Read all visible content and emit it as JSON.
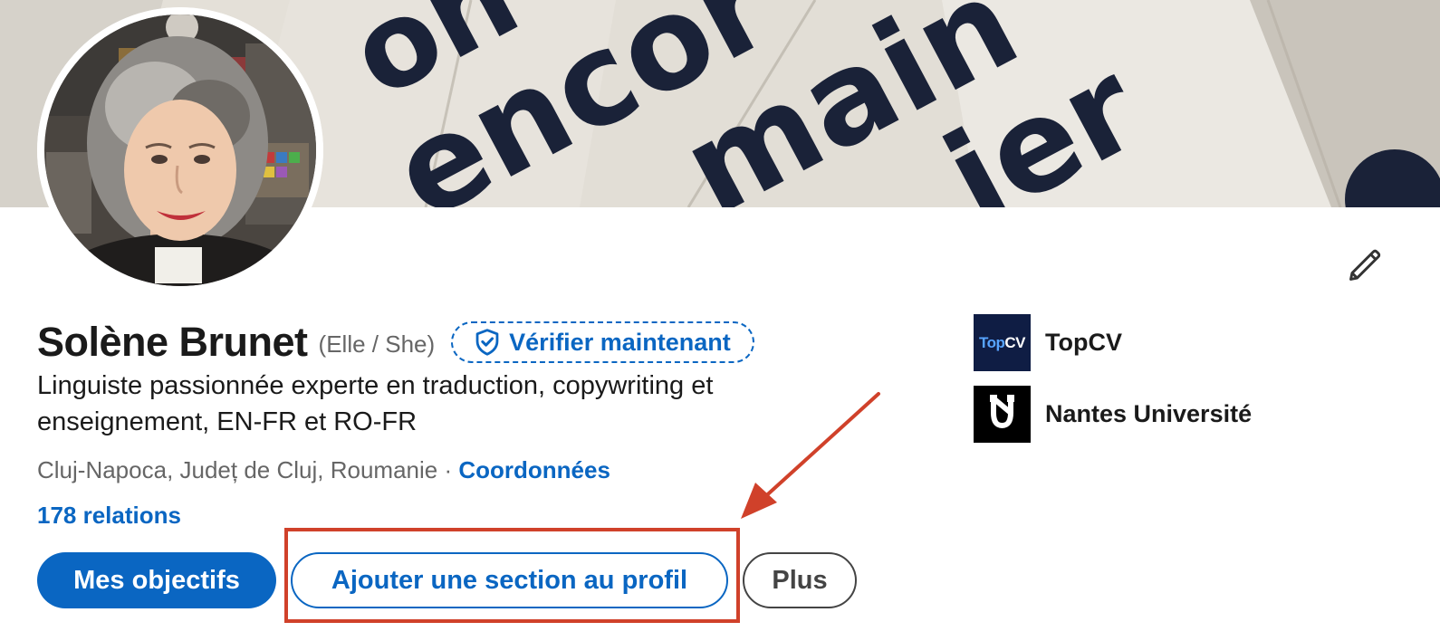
{
  "profile": {
    "name": "Solène Brunet",
    "pronouns": "(Elle / She)",
    "verify_label": "Vérifier maintenant",
    "headline": "Linguiste passionnée experte en traduction, copywriting et enseignement, EN-FR et RO-FR",
    "location": "Cluj-Napoca, Județ de Cluj, Roumanie",
    "location_separator": " · ",
    "contact_label": "Coordonnées",
    "connections": "178 relations"
  },
  "actions": {
    "primary_label": "Mes objectifs",
    "secondary_label": "Ajouter une section au profil",
    "more_label": "Plus"
  },
  "organizations": [
    {
      "name": "TopCV",
      "logo_text_a": "Top",
      "logo_text_b": "CV",
      "logo_icon": "topcv-logo"
    },
    {
      "name": "Nantes Université",
      "logo_icon": "nantes-universite-logo"
    }
  ],
  "banner": {
    "words": [
      "on",
      "encor",
      "main",
      "ier"
    ]
  },
  "icons": {
    "edit": "pencil-icon",
    "verify": "shield-check-icon"
  },
  "colors": {
    "accent": "#0a66c2",
    "annotation": "#d0412a",
    "banner_text": "#1a2238",
    "topcv_bg": "#0f1d44"
  }
}
